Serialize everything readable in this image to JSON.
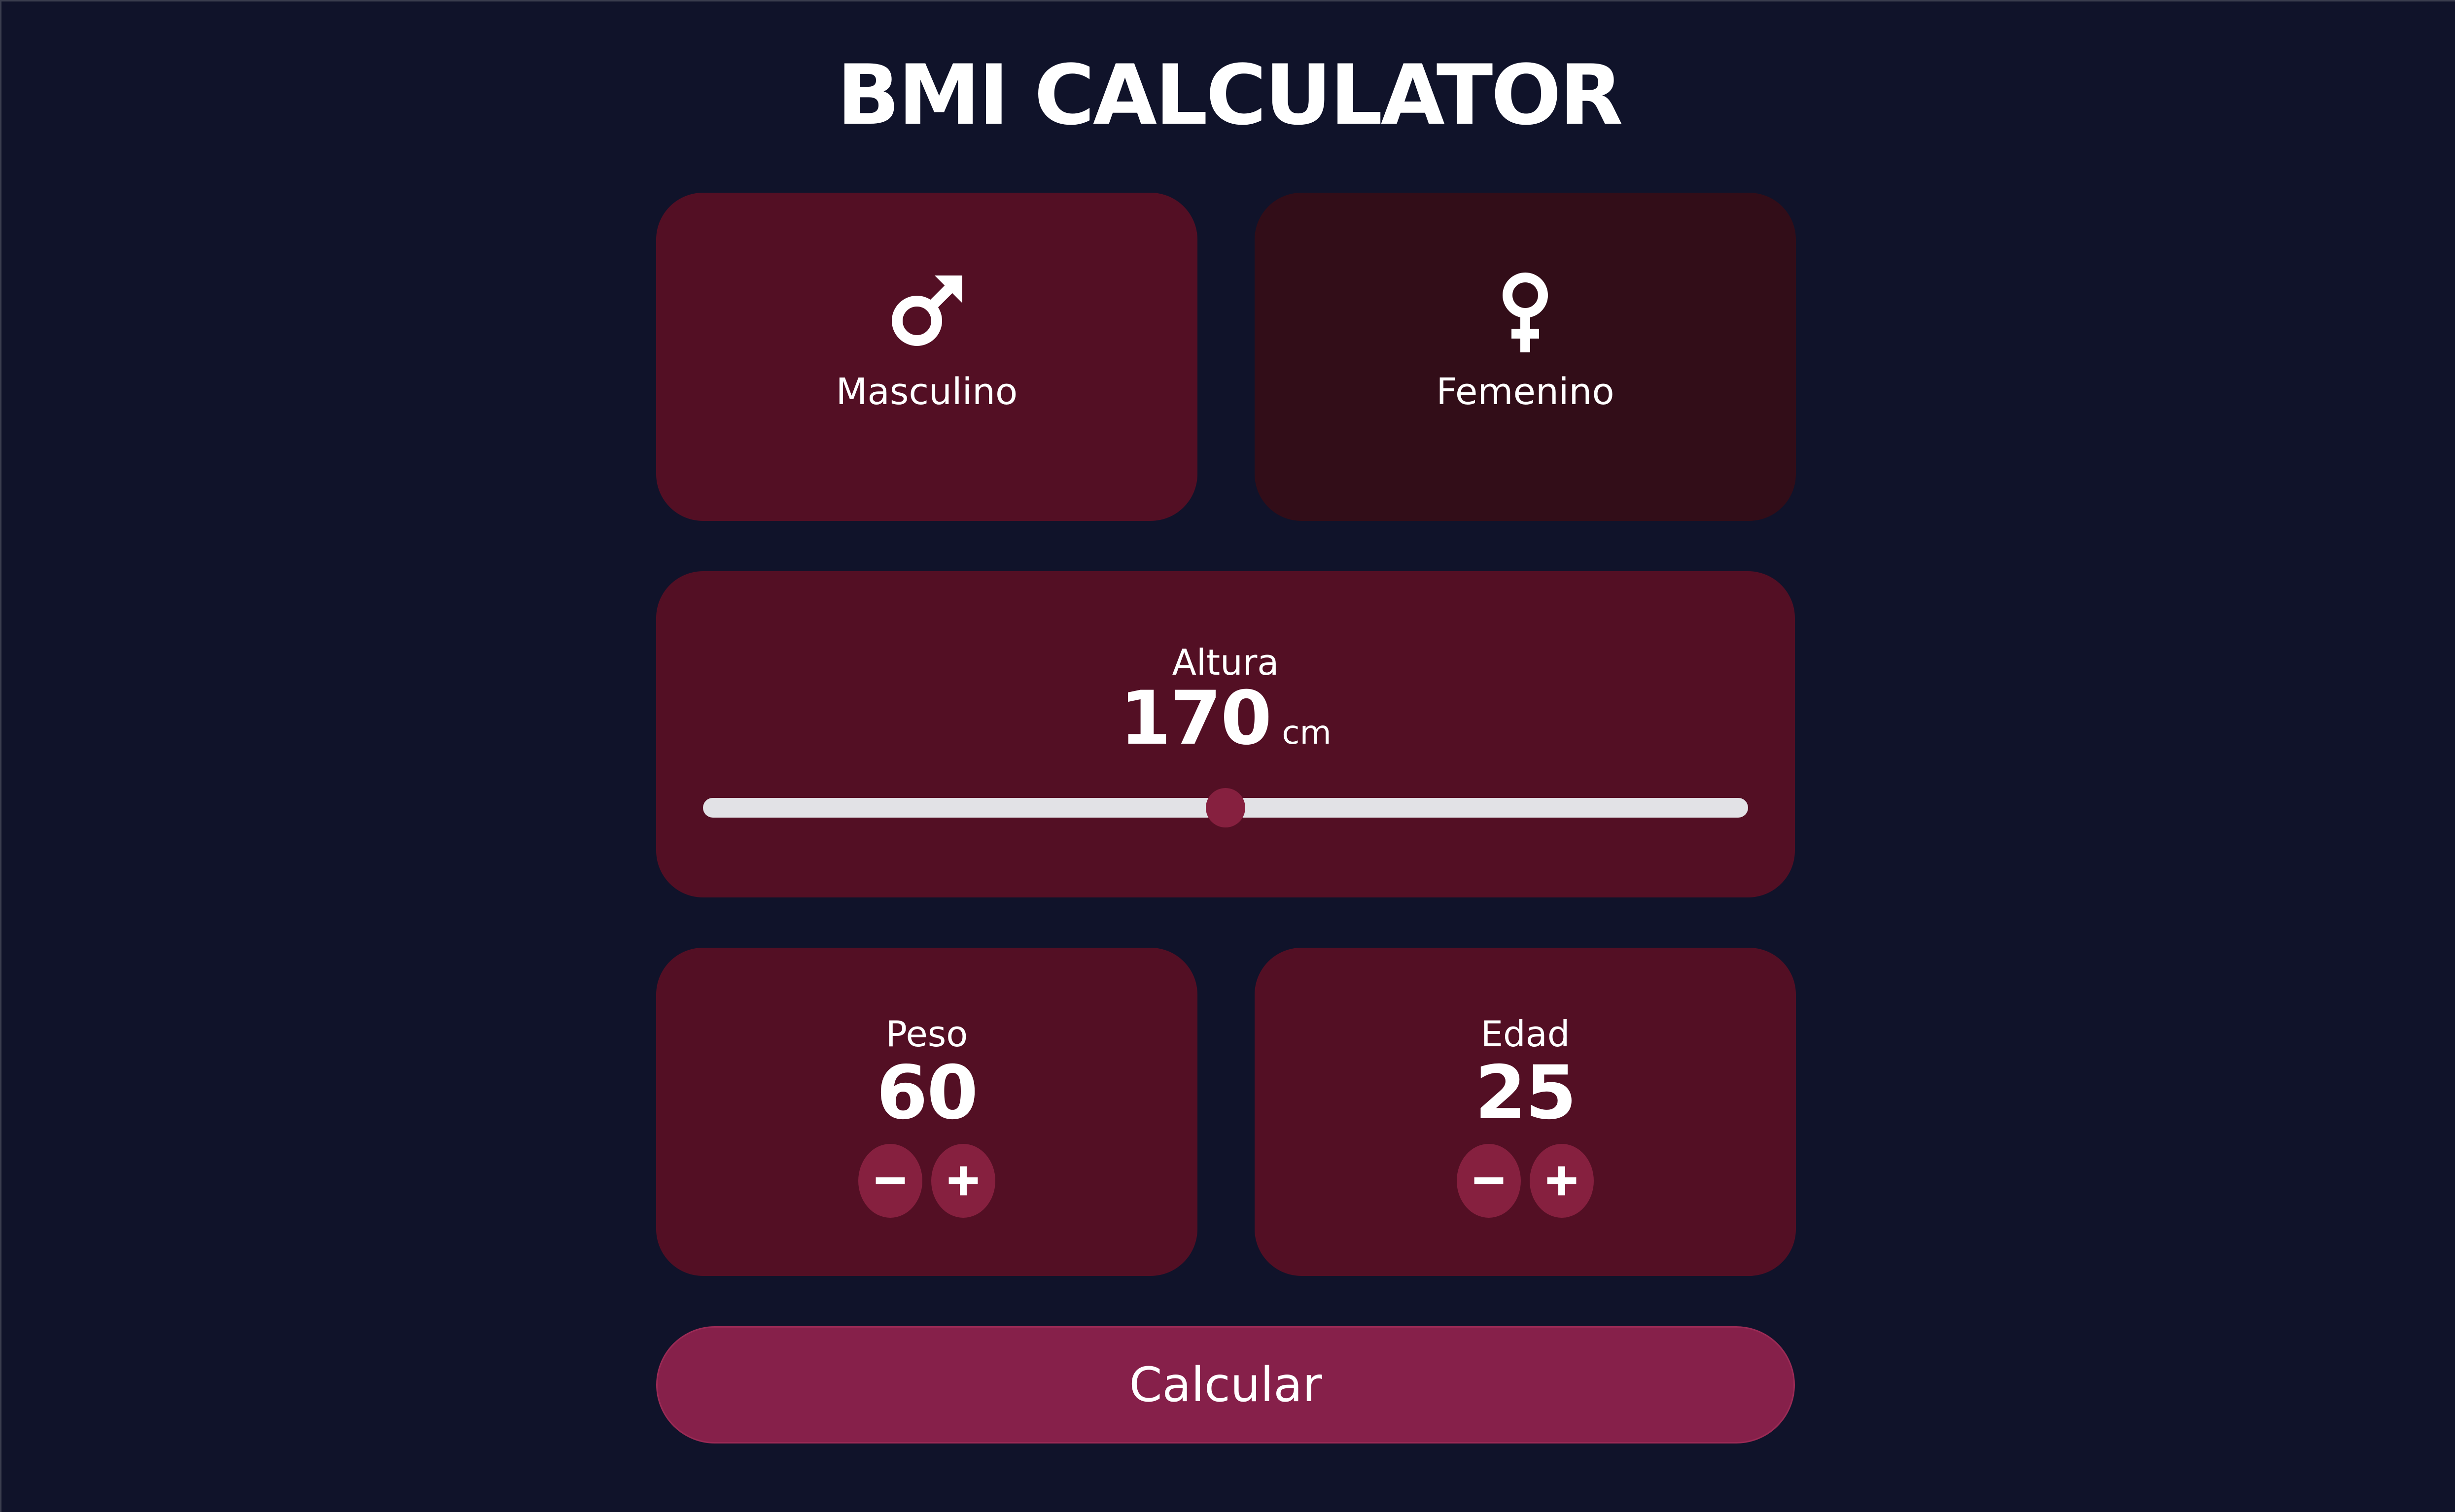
{
  "app": {
    "title": "BMI CALCULATOR"
  },
  "gender": {
    "selected": "male",
    "male_label": "Masculino",
    "female_label": "Femenino",
    "male_icon": "male-symbol-icon",
    "female_icon": "female-symbol-icon"
  },
  "height": {
    "label": "Altura",
    "value": "170",
    "unit": "cm",
    "slider_fraction": 0.5
  },
  "weight": {
    "label": "Peso",
    "value": "60",
    "decrement_icon": "minus-icon",
    "increment_icon": "plus-icon"
  },
  "age": {
    "label": "Edad",
    "value": "25",
    "decrement_icon": "minus-icon",
    "increment_icon": "plus-icon"
  },
  "actions": {
    "calculate_label": "Calcular"
  },
  "colors": {
    "background": "#10132a",
    "card": "#530f24",
    "card_inactive": "#320d18",
    "accent": "#86203f",
    "button": "#86204a",
    "track": "#e2e2e6"
  }
}
